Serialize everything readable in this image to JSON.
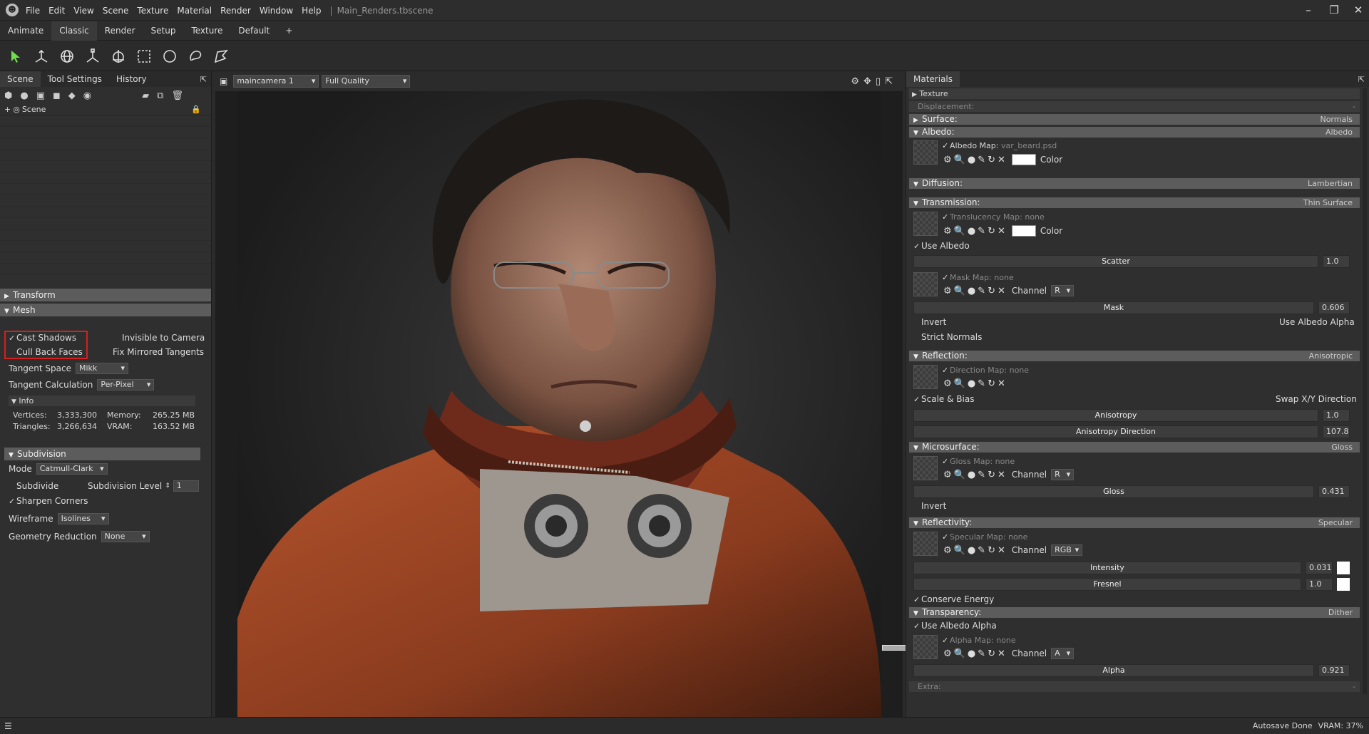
{
  "app": {
    "file": "Main_Renders.tbscene"
  },
  "menu": [
    "File",
    "Edit",
    "View",
    "Scene",
    "Texture",
    "Material",
    "Render",
    "Window",
    "Help"
  ],
  "layout_tabs": [
    "Animate",
    "Classic",
    "Render",
    "Setup",
    "Texture",
    "Default",
    "+"
  ],
  "left_tabs": [
    "Scene",
    "Tool Settings",
    "History"
  ],
  "scene_tree": {
    "root": "Scene"
  },
  "transform": {
    "title": "Transform"
  },
  "mesh": {
    "title": "Mesh",
    "cast_shadows": "Cast Shadows",
    "cull_back_faces": "Cull Back Faces",
    "invisible_to_camera": "Invisible to Camera",
    "fix_mirrored_tangents": "Fix Mirrored Tangents",
    "tangent_space_label": "Tangent Space",
    "tangent_space_value": "Mikk",
    "tangent_calc_label": "Tangent Calculation",
    "tangent_calc_value": "Per-Pixel"
  },
  "info": {
    "title": "Info",
    "vertices_label": "Vertices:",
    "vertices_value": "3,333,300",
    "triangles_label": "Triangles:",
    "triangles_value": "3,266,634",
    "memory_label": "Memory:",
    "memory_value": "265.25 MB",
    "vram_label": "VRAM:",
    "vram_value": "163.52 MB"
  },
  "subdivision": {
    "title": "Subdivision",
    "mode_label": "Mode",
    "mode_value": "Catmull-Clark",
    "subdivide": "Subdivide",
    "level_label": "Subdivision Level",
    "level_value": "1",
    "sharpen": "Sharpen Corners",
    "wireframe_label": "Wireframe",
    "wireframe_value": "Isolines",
    "reduction_label": "Geometry Reduction",
    "reduction_value": "None"
  },
  "viewport": {
    "camera": "maincamera 1",
    "quality": "Full Quality"
  },
  "materials": {
    "title": "Materials",
    "texture": "Texture",
    "displacement": "Displacement:",
    "displacement_value": "-",
    "surface": "Surface:",
    "surface_value": "Normals",
    "albedo": "Albedo:",
    "albedo_value": "Albedo",
    "albedo_map": "Albedo Map:",
    "albedo_map_file": "var_beard.psd",
    "color": "Color",
    "diffusion": "Diffusion:",
    "diffusion_value": "Lambertian",
    "transmission": "Transmission:",
    "transmission_value": "Thin Surface",
    "translucency_map": "Translucency Map: none",
    "use_albedo": "Use Albedo",
    "scatter": "Scatter",
    "scatter_value": "1.0",
    "mask_map": "Mask Map: none",
    "channel": "Channel",
    "channel_r": "R",
    "mask": "Mask",
    "mask_value": "0.606",
    "invert": "Invert",
    "use_albedo_alpha": "Use Albedo Alpha",
    "strict_normals": "Strict Normals",
    "reflection": "Reflection:",
    "reflection_value": "Anisotropic",
    "direction_map": "Direction Map: none",
    "scale_bias": "Scale & Bias",
    "swap_xy": "Swap X/Y Direction",
    "anisotropy": "Anisotropy",
    "anisotropy_value": "1.0",
    "anisotropy_dir": "Anisotropy Direction",
    "anisotropy_dir_value": "107.8",
    "microsurface": "Microsurface:",
    "microsurface_value": "Gloss",
    "gloss_map": "Gloss Map: none",
    "gloss": "Gloss",
    "gloss_value": "0.431",
    "reflectivity": "Reflectivity:",
    "reflectivity_value": "Specular",
    "specular_map": "Specular Map: none",
    "channel_rgb": "RGB",
    "intensity": "Intensity",
    "intensity_value": "0.031",
    "fresnel": "Fresnel",
    "fresnel_value": "1.0",
    "conserve_energy": "Conserve Energy",
    "transparency": "Transparency:",
    "transparency_value": "Dither",
    "use_albedo_alpha2": "Use Albedo Alpha",
    "alpha_map": "Alpha Map: none",
    "channel_a": "A",
    "alpha": "Alpha",
    "alpha_value": "0.921",
    "extra": "Extra:",
    "extra_value": "-"
  },
  "status": {
    "autosave": "Autosave Done",
    "vram": "VRAM: 37%"
  },
  "colors": {
    "highlight": "#d61f1f",
    "section": "#5c5c5c",
    "accent_green": "#6ee04a"
  }
}
